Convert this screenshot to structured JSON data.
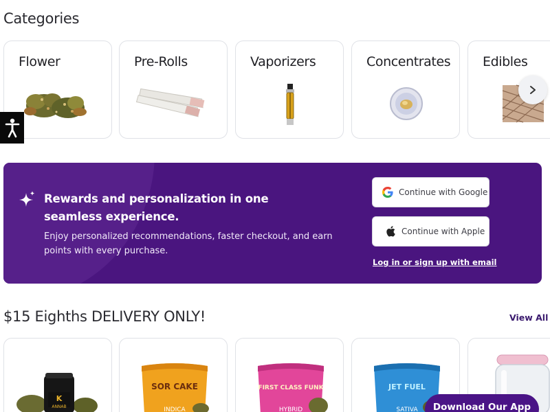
{
  "categories": {
    "title": "Categories",
    "items": [
      {
        "label": "Flower"
      },
      {
        "label": "Pre-Rolls"
      },
      {
        "label": "Vaporizers"
      },
      {
        "label": "Concentrates"
      },
      {
        "label": "Edibles"
      }
    ]
  },
  "banner": {
    "title": "Rewards and personalization in one seamless experience.",
    "body": "Enjoy personalized recommendations, faster checkout, and earn points with every purchase.",
    "google_label": "Continue with Google",
    "apple_label": "Continue with Apple",
    "email_link": "Log in or sign up with email",
    "colors": {
      "background": "#4a157f",
      "accent": "#56208a"
    }
  },
  "deals": {
    "title": "$15 Eighths DELIVERY ONLY!",
    "view_all": "View All",
    "products": [
      {
        "brand_text": "K",
        "strain": "ANNAB"
      },
      {
        "brand_text": "SOR CAKE",
        "strain": "INDICA"
      },
      {
        "brand_text": "FIRST CLASS FUNK",
        "strain": "HYBRID"
      },
      {
        "brand_text": "JET FUEL",
        "strain": "SATIVA"
      },
      {
        "brand_text": "",
        "strain": ""
      }
    ]
  },
  "floating": {
    "download_label": "Download Our App"
  },
  "icons": {
    "scroll": "chevron-right-icon",
    "accessibility": "accessibility-icon",
    "sparkle": "sparkle-icon",
    "google": "google-icon",
    "apple": "apple-icon"
  }
}
